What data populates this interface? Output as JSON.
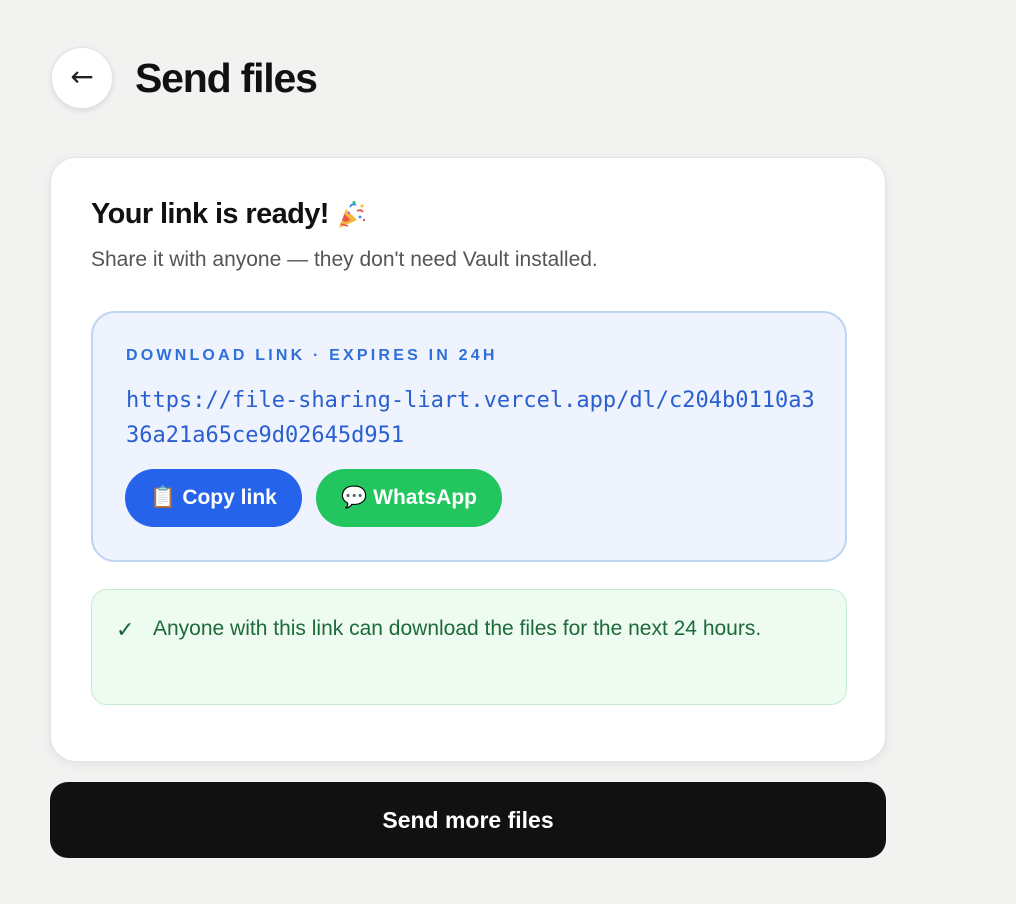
{
  "header": {
    "back_icon": "left-arrow-icon",
    "title": "Send files"
  },
  "card": {
    "title": "Your link is ready!",
    "title_icon": "party-popper-icon",
    "subtitle": "Share it with anyone — they don't need Vault installed.",
    "link_box": {
      "label": "DOWNLOAD LINK · EXPIRES IN 24H",
      "url": "https://file-sharing-liart.vercel.app/dl/c204b0110a336a21a65ce9d02645d951",
      "copy_button": {
        "icon": "📋",
        "label": "Copy link",
        "color": "#2563eb"
      },
      "whatsapp_button": {
        "icon": "💬",
        "label": "WhatsApp",
        "color": "#22c55e"
      }
    },
    "notice": {
      "icon": "✓",
      "text": "Anyone with this link can download the files for the next 24 hours."
    }
  },
  "footer": {
    "send_more_label": "Send more files"
  },
  "colors": {
    "background": "#f2f2f1",
    "accent_blue": "#2563eb",
    "accent_green": "#22c55e",
    "link_text": "#2a5fd0",
    "notice_text": "#1d6a3a"
  }
}
